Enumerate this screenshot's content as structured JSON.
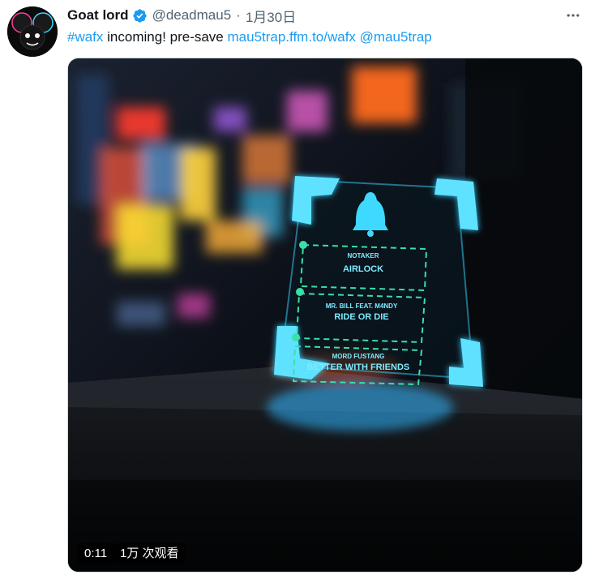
{
  "tweet": {
    "author_name": "Goat lord",
    "handle": "@deadmau5",
    "separator": "·",
    "time": "1月30日",
    "text": {
      "hashtag": "#wafx",
      "body": " incoming! pre-save ",
      "link": "mau5trap.ffm.to/wafx",
      "space": " ",
      "mention": "@mau5trap"
    }
  },
  "video": {
    "duration": "0:11",
    "views": "1万 次观看",
    "tracks": [
      {
        "artist": "NOTAKER",
        "title": "AIRLOCK"
      },
      {
        "artist": "MR. BILL FEAT. M4NDY",
        "title": "RIDE OR DIE"
      },
      {
        "artist": "MORD FUSTANG",
        "title": "BETTER WITH FRIENDS"
      }
    ]
  },
  "icons": {
    "verified": "verified-badge-icon",
    "more": "more-icon",
    "bell": "bell-icon"
  },
  "colors": {
    "link": "#1d9bf0",
    "text": "#0f1419",
    "muted": "#536471",
    "neon": "#36d6ff"
  }
}
